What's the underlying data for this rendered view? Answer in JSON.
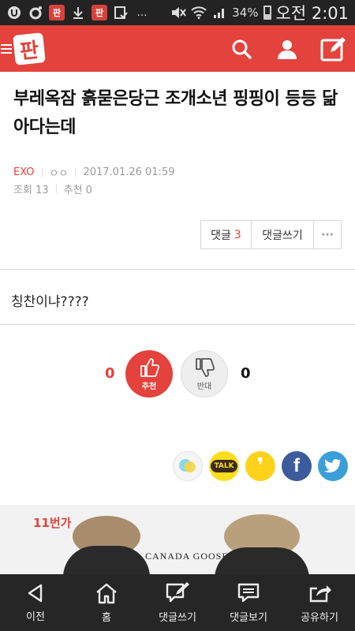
{
  "status_bar": {
    "battery": "34%",
    "time": "오전 2:01"
  },
  "app": {
    "logo": "판",
    "accent_color": "#e4423c"
  },
  "post": {
    "title": "부레옥잠 흙묻은당근 조개소년 핑핑이 등등 닮아다는데",
    "category": "EXO",
    "author": "ㅇㅇ",
    "date": "2017.01.26 01:59",
    "views_label": "조회 13",
    "recommend_label": "추천 0",
    "body": "칭찬이냐????"
  },
  "comment_bar": {
    "comments_label": "댓글",
    "comments_count": "3",
    "write_label": "댓글쓰기",
    "more_label": "···"
  },
  "votes": {
    "up_count": "0",
    "up_label": "추천",
    "down_count": "0",
    "down_label": "반대"
  },
  "share": {
    "items": [
      "kakao-story",
      "kakao-talk",
      "kakao-page",
      "facebook",
      "twitter"
    ],
    "talk_label": "TALK",
    "page_glyph": "❜",
    "facebook_glyph": "f"
  },
  "ad": {
    "badge": "11번가",
    "brand": "CANADA GOOSE"
  },
  "bottom_nav": {
    "items": [
      {
        "label": "이전",
        "icon": "back-icon"
      },
      {
        "label": "홈",
        "icon": "home-icon"
      },
      {
        "label": "댓글쓰기",
        "icon": "write-comment-icon"
      },
      {
        "label": "댓글보기",
        "icon": "view-comments-icon"
      },
      {
        "label": "공유하기",
        "icon": "share-icon"
      }
    ]
  }
}
